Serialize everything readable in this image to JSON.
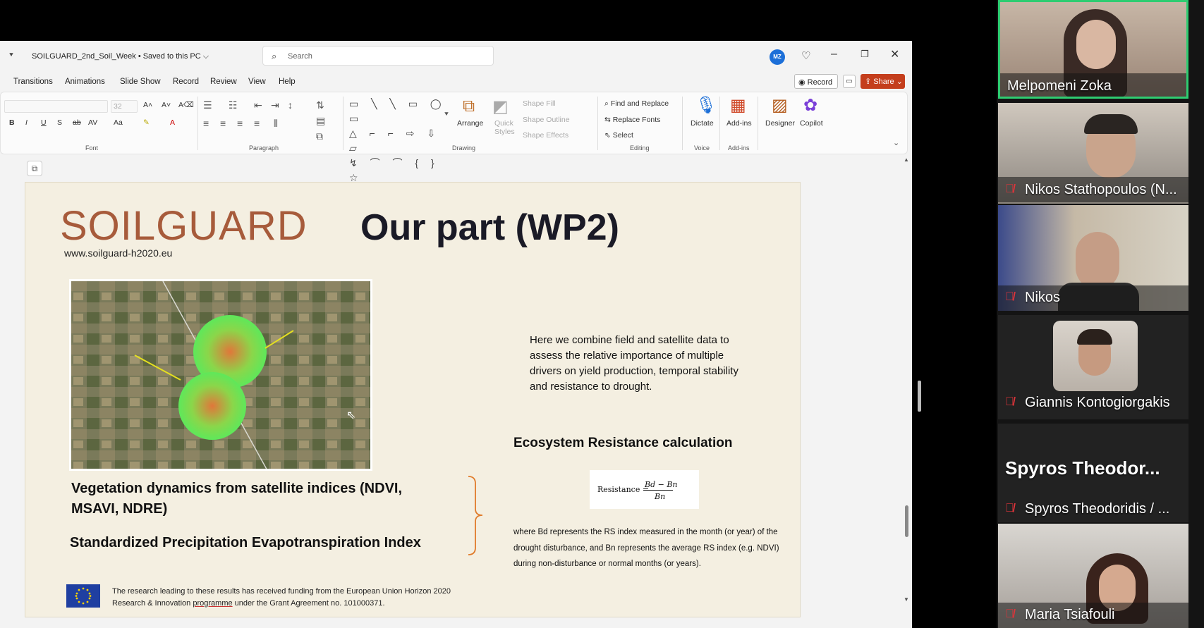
{
  "titlebar": {
    "qat": "⯆",
    "doc_title": "SOILGUARD_2nd_Soil_Week • Saved to this PC ⌵",
    "search_placeholder": "Search",
    "avatar_initials": "MZ"
  },
  "menu": {
    "items": [
      "Transitions",
      "Animations",
      "Slide Show",
      "Record",
      "Review",
      "View",
      "Help"
    ],
    "record_label": "Record",
    "share_label": "Share"
  },
  "ribbon": {
    "font_size_value": "32",
    "groups": [
      "Font",
      "Paragraph",
      "Drawing",
      "Editing",
      "Voice",
      "Add-ins"
    ],
    "arrange": "Arrange",
    "quick_styles": "Quick Styles",
    "shape_fill": "Shape Fill",
    "shape_outline": "Shape Outline",
    "shape_effects": "Shape Effects",
    "find_replace": "Find and Replace",
    "replace_fonts": "Replace Fonts",
    "select": "Select",
    "dictate": "Dictate",
    "addins": "Add-ins",
    "designer": "Designer",
    "copilot": "Copilot"
  },
  "slide": {
    "logo": "SOILGUARD",
    "logo_url": "www.soilguard-h2020.eu",
    "title": "Our part (WP2)",
    "description": "Here we combine field and satellite data to assess the relative importance of multiple drivers on yield production, temporal stability and resistance to drought.",
    "eco_heading": "Ecosystem Resistance calculation",
    "formula_lhs": "Resistance =",
    "formula_num": "Bd − Bn",
    "formula_den": "Bn",
    "veg_heading": "Vegetation dynamics from satellite indices (NDVI, MSAVI, NDRE)",
    "spei_heading": "Standardized Precipitation Evapotranspiration Index",
    "where_text": "where Bd represents the RS index measured in the month (or year) of the drought disturbance, and Bn represents the average RS index (e.g. NDVI) during non-disturbance or normal months (or years).",
    "funding_pre": "The research leading to these results has received funding from the European Union Horizon 2020 Research & Innovation",
    "funding_ul": "programme",
    "funding_post": "under the Grant Agreement no. 101000371."
  },
  "participants": [
    {
      "name": "Melpomeni Zoka",
      "muted": false,
      "speaking": true
    },
    {
      "name": "Nikos Stathopoulos (N...",
      "muted": true
    },
    {
      "name": "Nikos",
      "muted": true
    },
    {
      "name": "Giannis Kontogiorgakis",
      "muted": true
    },
    {
      "name": "Spyros Theodoridis / ...",
      "muted": true,
      "big_label": "Spyros Theodor..."
    },
    {
      "name": "Maria Tsiafouli",
      "muted": true
    }
  ],
  "colors": {
    "share": "#c43e1c",
    "logo": "#a75b3b",
    "speaking_border": "#2ecc71",
    "muted_icon": "#e0343a"
  }
}
